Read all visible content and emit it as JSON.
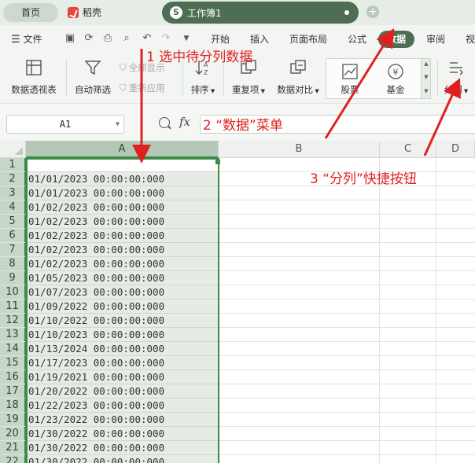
{
  "tabs": {
    "home": "首页",
    "docer": "稻壳",
    "workbook": "工作簿1",
    "workbook_icon": "S",
    "add_tab_icon": "+"
  },
  "menu": {
    "file": "文件",
    "items": [
      "开始",
      "插入",
      "页面布局",
      "公式",
      "数据",
      "审阅",
      "视"
    ],
    "active": "数据"
  },
  "ribbon": {
    "pivot_table": "数据透视表",
    "auto_filter": "自动筛选",
    "show_all": "全部显示",
    "reapply": "重新应用",
    "sort": "排序",
    "duplicates": "重复项",
    "compare": "数据对比",
    "stocks": "股票",
    "funds": "基金",
    "split_column": "分列"
  },
  "formula_bar": {
    "cell_ref": "A1",
    "fx_label": "fx",
    "content": ""
  },
  "grid": {
    "columns": [
      "A",
      "B",
      "C",
      "D"
    ],
    "selected_column": "A",
    "rows": [
      {
        "num": "1",
        "a": ""
      },
      {
        "num": "2",
        "a": "01/01/2023 00:00:00:000"
      },
      {
        "num": "3",
        "a": "01/01/2023 00:00:00:000"
      },
      {
        "num": "4",
        "a": "01/02/2023 00:00:00:000"
      },
      {
        "num": "5",
        "a": "01/02/2023 00:00:00:000"
      },
      {
        "num": "6",
        "a": "01/02/2023 00:00:00:000"
      },
      {
        "num": "7",
        "a": "01/02/2023 00:00:00:000"
      },
      {
        "num": "8",
        "a": "01/02/2023 00:00:00:000"
      },
      {
        "num": "9",
        "a": "01/05/2023 00:00:00:000"
      },
      {
        "num": "10",
        "a": "01/07/2023 00:00:00:000"
      },
      {
        "num": "11",
        "a": "01/09/2022 00:00:00:000"
      },
      {
        "num": "12",
        "a": "01/10/2022 00:00:00:000"
      },
      {
        "num": "13",
        "a": "01/10/2023 00:00:00:000"
      },
      {
        "num": "14",
        "a": "01/13/2024 00:00:00:000"
      },
      {
        "num": "15",
        "a": "01/17/2023 00:00:00:000"
      },
      {
        "num": "16",
        "a": "01/19/2021 00:00:00:000"
      },
      {
        "num": "17",
        "a": "01/20/2022 00:00:00:000"
      },
      {
        "num": "18",
        "a": "01/22/2023 00:00:00:000"
      },
      {
        "num": "19",
        "a": "01/23/2022 00:00:00:000"
      },
      {
        "num": "20",
        "a": "01/30/2022 00:00:00:000"
      },
      {
        "num": "21",
        "a": "01/30/2022 00:00:00:000"
      },
      {
        "num": "22",
        "a": "01/30/2022 00:00:00:000"
      }
    ]
  },
  "annotations": {
    "step1": "1  选中待分列数据",
    "step2": "2  “数据”菜单",
    "step3": "3  “分列”快捷按钮"
  },
  "colors": {
    "accent": "#4d6e52",
    "selection": "#3d8a48",
    "annotation": "#e02020"
  }
}
